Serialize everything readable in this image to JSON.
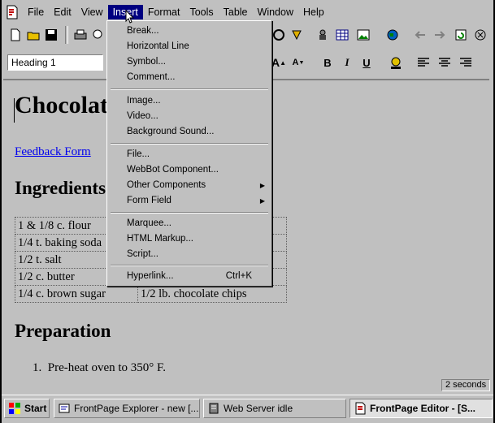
{
  "menubar": {
    "items": [
      "File",
      "Edit",
      "View",
      "Insert",
      "Format",
      "Tools",
      "Table",
      "Window",
      "Help"
    ],
    "active": "Insert"
  },
  "toolbar": {
    "style_value": "Heading 1"
  },
  "insert_menu": {
    "items": [
      {
        "label": "Break..."
      },
      {
        "label": "Horizontal Line"
      },
      {
        "label": "Symbol..."
      },
      {
        "label": "Comment..."
      },
      {
        "label": "Image..."
      },
      {
        "label": "Video..."
      },
      {
        "label": "Background Sound..."
      },
      {
        "label": "File..."
      },
      {
        "label": "WebBot Component..."
      },
      {
        "label": "Other Components",
        "submenu": true
      },
      {
        "label": "Form Field",
        "submenu": true
      },
      {
        "label": "Marquee..."
      },
      {
        "label": "HTML Markup..."
      },
      {
        "label": "Script..."
      },
      {
        "label": "Hyperlink...",
        "shortcut": "Ctrl+K"
      }
    ]
  },
  "document": {
    "title": "Chocolate Chip Cookies",
    "link": "Feedback Form",
    "ingredients_heading": "Ingredients",
    "ingredients": [
      [
        "1 & 1/8 c. flour",
        ""
      ],
      [
        "1/4 t. baking soda",
        ""
      ],
      [
        "1/2 t. salt",
        ""
      ],
      [
        "1/2 c. butter",
        ""
      ],
      [
        "1/4 c. brown sugar",
        "1/2 lb. chocolate chips"
      ]
    ],
    "preparation_heading": "Preparation",
    "steps": [
      "Pre-heat oven to 350° F."
    ]
  },
  "status": {
    "time_text": "2 seconds"
  },
  "taskbar": {
    "start": "Start",
    "tasks": [
      {
        "label": "FrontPage Explorer - new [..."
      },
      {
        "label": "Web Server idle"
      },
      {
        "label": "FrontPage Editor - [S..."
      }
    ]
  }
}
